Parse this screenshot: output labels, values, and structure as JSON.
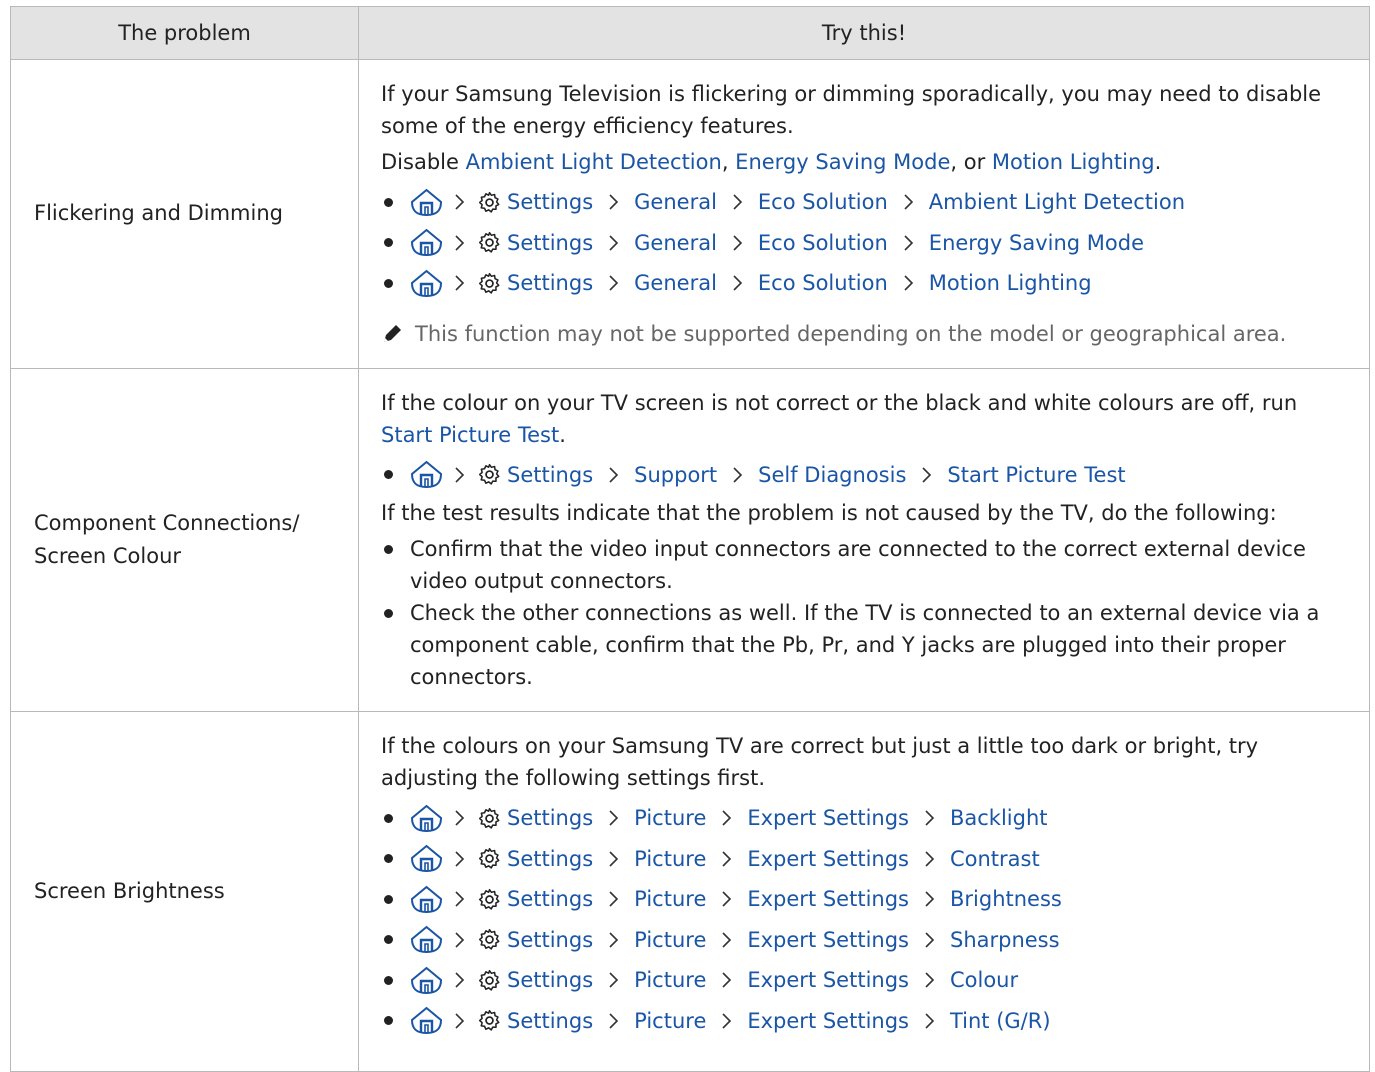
{
  "table": {
    "header": {
      "problem": "The problem",
      "solution": "Try this!"
    },
    "rows": [
      {
        "problem": "Flickering and Dimming",
        "intro": "If your Samsung Television is flickering or dimming sporadically, you may need to disable some of the energy efficiency features.",
        "disable": {
          "prefix": "Disable ",
          "link1": "Ambient Light Detection",
          "sep1": ", ",
          "link2": "Energy Saving Mode",
          "sep2": ", or ",
          "link3": "Motion Lighting",
          "suffix": "."
        },
        "paths": [
          [
            "Settings",
            "General",
            "Eco Solution",
            "Ambient Light Detection"
          ],
          [
            "Settings",
            "General",
            "Eco Solution",
            "Energy Saving Mode"
          ],
          [
            "Settings",
            "General",
            "Eco Solution",
            "Motion Lighting"
          ]
        ],
        "note": "This function may not be supported depending on the model or geographical area."
      },
      {
        "problem": "Component Connections/ Screen Colour",
        "intro": "If the colour on your TV screen is not correct or the black and white colours are off, run ",
        "intro_link": "Start Picture Test",
        "intro_suffix": ".",
        "paths": [
          [
            "Settings",
            "Support",
            "Self Diagnosis",
            "Start Picture Test"
          ]
        ],
        "after": "If the test results indicate that the problem is not caused by the TV, do the following:",
        "bullets": [
          "Confirm that the video input connectors are connected to the correct external device video output connectors.",
          "Check the other connections as well. If the TV is connected to an external device via a component cable, confirm that the Pb, Pr, and Y jacks are plugged into their proper connectors."
        ]
      },
      {
        "problem": "Screen Brightness",
        "intro": "If the colours on your Samsung TV are correct but just a little too dark or bright, try adjusting the following settings first.",
        "paths": [
          [
            "Settings",
            "Picture",
            "Expert Settings",
            "Backlight"
          ],
          [
            "Settings",
            "Picture",
            "Expert Settings",
            "Contrast"
          ],
          [
            "Settings",
            "Picture",
            "Expert Settings",
            "Brightness"
          ],
          [
            "Settings",
            "Picture",
            "Expert Settings",
            "Sharpness"
          ],
          [
            "Settings",
            "Picture",
            "Expert Settings",
            "Colour"
          ],
          [
            "Settings",
            "Picture",
            "Expert Settings",
            "Tint (G/R)"
          ]
        ]
      }
    ]
  },
  "icons": {
    "home": "home-icon",
    "settings": "gear-icon",
    "separator": "chevron-right-icon",
    "note": "pencil-icon"
  },
  "colors": {
    "link": "#1a55a6",
    "header_bg": "#e3e3e3",
    "border": "#b9b9b9",
    "note_text": "#666666"
  }
}
